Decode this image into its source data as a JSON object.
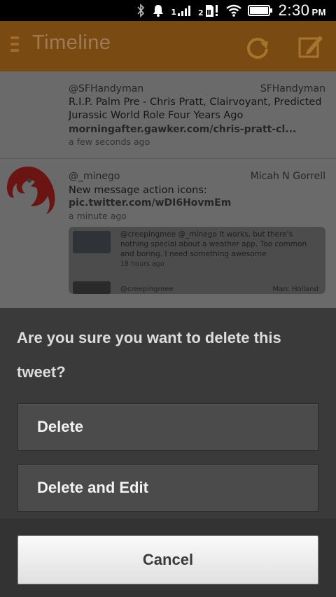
{
  "status_bar": {
    "time": "2:30",
    "ampm": "PM",
    "sim1_label": "1",
    "sim2_label": "2"
  },
  "header": {
    "title": "Timeline"
  },
  "timeline": {
    "tweets": [
      {
        "handle": "@SFHandyman",
        "name": "SFHandyman",
        "text": "R.I.P. Palm Pre - Chris Pratt, Clairvoyant, Predicted Jurassic World Role Four Years Ago",
        "link": "morningafter.gawker.com/chris-pratt-cl...",
        "time": "a few seconds ago"
      },
      {
        "handle": "@_minego",
        "name": "Micah N Gorrell",
        "text": "New message action icons:",
        "link": "pic.twitter.com/wDI6HovmEm",
        "time": "a minute ago",
        "embed": {
          "text": "@creepingmee @_minego It works, but there's nothing special about a weather app. Too common and boring. I need something awesome",
          "time": "18 hours ago",
          "next_handle": "@creepingmee",
          "next_name": "Marc Holland"
        }
      }
    ]
  },
  "dialog": {
    "question": "Are you sure you want to delete this tweet?",
    "delete_label": "Delete",
    "delete_edit_label": "Delete and Edit",
    "cancel_label": "Cancel"
  },
  "colors": {
    "header": "#7a4a13",
    "dialog_bg": "#3a3a3a",
    "button_bg": "#4b4b4b"
  }
}
